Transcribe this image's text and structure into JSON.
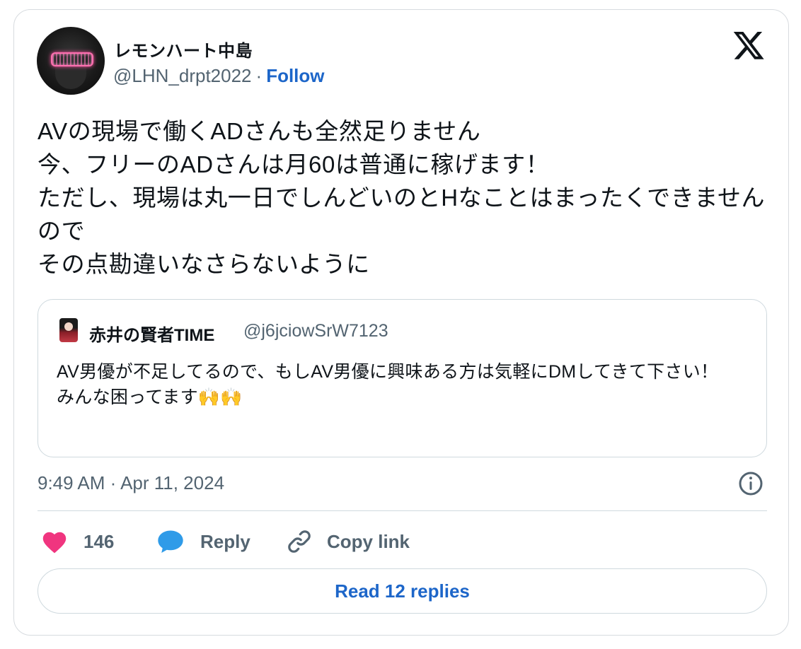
{
  "author": {
    "name": "レモンハート中島",
    "handle": "@LHN_drpt2022",
    "separator": "·",
    "follow_label": "Follow"
  },
  "tweet": {
    "text": "AVの現場で働くADさんも全然足りません\n今、フリーのADさんは月60は普通に稼げます！\nただし、現場は丸一日でしんどいのとHなことはまったくできませんので\nその点勘違いなさらないように"
  },
  "quote": {
    "name": "赤井の賢者TIME",
    "handle": "@j6jciowSrW7123",
    "text": "AV男優が不足してるので、もしAV男優に興味ある方は気軽にDMしてきて下さい！\nみんな困ってます🙌🙌"
  },
  "meta": {
    "timestamp": "9:49 AM · Apr 11, 2024"
  },
  "actions": {
    "like_count": "146",
    "reply_label": "Reply",
    "copy_label": "Copy link"
  },
  "footer": {
    "read_replies_label": "Read 12 replies"
  },
  "colors": {
    "link": "#1d66c9",
    "like": "#f0357f",
    "reply_bubble": "#2f9be8",
    "muted": "#536471"
  }
}
